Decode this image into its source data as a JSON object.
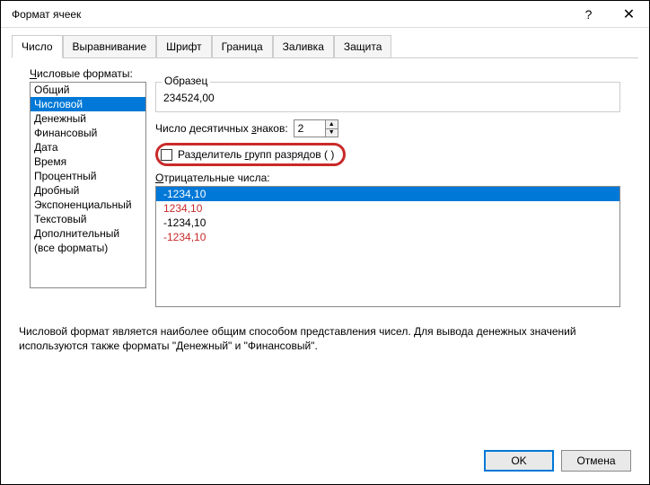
{
  "dialog": {
    "title": "Формат ячеек",
    "help_icon": "?",
    "close_icon": "✕"
  },
  "tabs": {
    "items": [
      "Число",
      "Выравнивание",
      "Шрифт",
      "Граница",
      "Заливка",
      "Защита"
    ],
    "active_index": 0
  },
  "formats": {
    "label": "Числовые форматы:",
    "items": [
      "Общий",
      "Числовой",
      "Денежный",
      "Финансовый",
      "Дата",
      "Время",
      "Процентный",
      "Дробный",
      "Экспоненциальный",
      "Текстовый",
      "Дополнительный",
      "(все форматы)"
    ],
    "selected_index": 1
  },
  "sample": {
    "label": "Образец",
    "value": "234524,00"
  },
  "decimal": {
    "label": "Число десятичных знаков:",
    "value": "2"
  },
  "separator": {
    "label": "Разделитель групп разрядов ( )",
    "checked": false
  },
  "negative": {
    "label": "Отрицательные числа:",
    "items": [
      {
        "text": "-1234,10",
        "red": false,
        "selected": true
      },
      {
        "text": "1234,10",
        "red": true,
        "selected": false
      },
      {
        "text": "-1234,10",
        "red": false,
        "selected": false
      },
      {
        "text": "-1234,10",
        "red": true,
        "selected": false
      }
    ]
  },
  "description": "Числовой формат является наиболее общим способом представления чисел. Для вывода денежных значений используются также форматы \"Денежный\" и \"Финансовый\".",
  "buttons": {
    "ok": "OK",
    "cancel": "Отмена"
  }
}
